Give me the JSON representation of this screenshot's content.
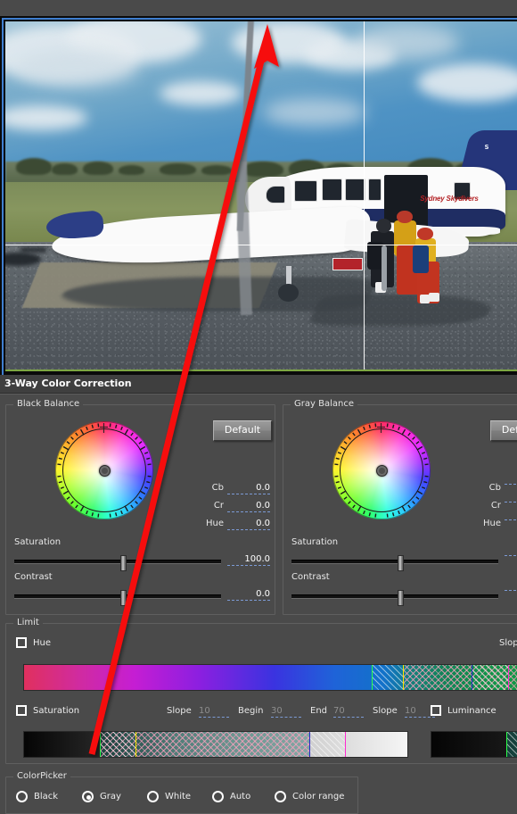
{
  "panel": {
    "title": "3-Way Color Correction"
  },
  "video": {
    "plane_text": "Sydney Skydivers",
    "tail_text": "S"
  },
  "black_balance": {
    "group_title": "Black Balance",
    "default_label": "Default",
    "cb_label": "Cb",
    "cb_value": "0.0",
    "cr_label": "Cr",
    "cr_value": "0.0",
    "hue_label": "Hue",
    "hue_value": "0.0",
    "saturation_label": "Saturation",
    "saturation_value": "100.0",
    "contrast_label": "Contrast",
    "contrast_value": "0.0"
  },
  "gray_balance": {
    "group_title": "Gray Balance",
    "default_label": "Default",
    "cb_label": "Cb",
    "cr_label": "Cr",
    "hue_label": "Hue",
    "saturation_label": "Saturation",
    "contrast_label": "Contrast"
  },
  "limit": {
    "group_title": "Limit",
    "hue_label": "Hue",
    "hue_slope_right_label": "Slop",
    "saturation_label": "Saturation",
    "luminance_label": "Luminance",
    "sat_slope1_label": "Slope",
    "sat_slope1_value": "10",
    "sat_begin_label": "Begin",
    "sat_begin_value": "30",
    "sat_end_label": "End",
    "sat_end_value": "70",
    "sat_slope2_label": "Slope",
    "sat_slope2_value": "10"
  },
  "colorpicker": {
    "group_title": "ColorPicker",
    "options": [
      {
        "label": "Black",
        "selected": false
      },
      {
        "label": "Gray",
        "selected": true
      },
      {
        "label": "White",
        "selected": false
      },
      {
        "label": "Auto",
        "selected": false
      },
      {
        "label": "Color range",
        "selected": false
      }
    ]
  },
  "annotation": {
    "arrow_color": "#f60c0c"
  },
  "colors": {
    "panel_bg": "#4a4a4a",
    "header_bg": "#3f3f3f",
    "selection_border": "#3f7fd0",
    "dashed_underline": "#7c9ad4",
    "green_line": "#7da642"
  }
}
